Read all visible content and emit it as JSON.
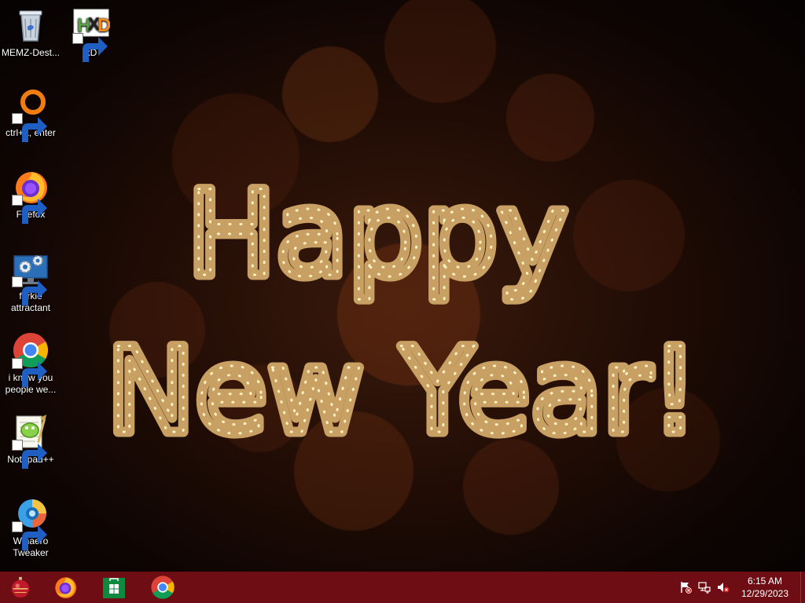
{
  "desktop": {
    "greeting_line1": "Happy",
    "greeting_line2": "New Year!",
    "icons": [
      {
        "label": "MEMZ-Dest...",
        "icon": "recycle-bin-icon"
      },
      {
        "label": "xD",
        "icon": "hxd-icon"
      },
      {
        "label": "ctrl+a, enter",
        "icon": "orange-ring-icon"
      },
      {
        "label": "Firefox",
        "icon": "firefox-icon"
      },
      {
        "label": "forkie attractant",
        "icon": "system-settings-icon"
      },
      {
        "label": "i know you people we...",
        "icon": "chrome-icon"
      },
      {
        "label": "Notepad++",
        "icon": "notepad-plus-plus-icon"
      },
      {
        "label": "Winaero Tweaker",
        "icon": "winaero-tweaker-icon"
      }
    ]
  },
  "taskbar": {
    "pinned": [
      {
        "name": "start-button",
        "icon": "ornament-start-icon"
      },
      {
        "name": "firefox",
        "icon": "firefox-icon"
      },
      {
        "name": "microsoft-store",
        "icon": "store-icon"
      },
      {
        "name": "chrome",
        "icon": "chrome-icon"
      }
    ],
    "tray": {
      "icons": [
        "action-center-flag-icon",
        "network-icon",
        "volume-muted-icon"
      ],
      "time": "6:15 AM",
      "date": "12/29/2023"
    }
  },
  "colors": {
    "taskbar": "#6e0e14",
    "bulb_outline": "#c9a063",
    "bulb_light": "#fff3c4"
  }
}
